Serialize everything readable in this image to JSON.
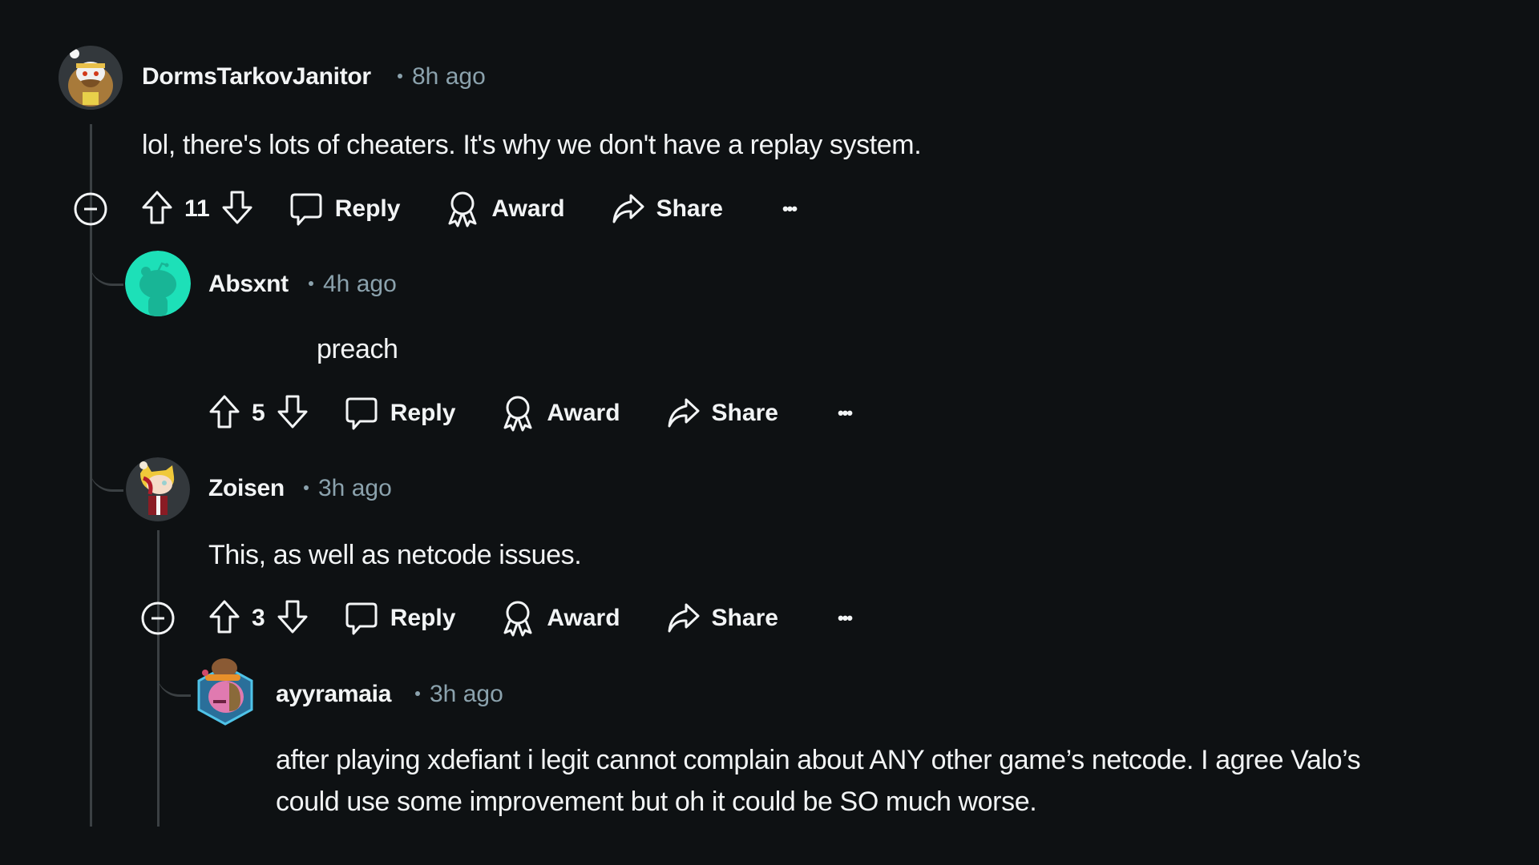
{
  "colors": {
    "background": "#0e1113",
    "text": "#f2f4f5",
    "meta_text": "#8ba2ad",
    "thread_line": "#3b4043",
    "absxnt_avatar": "#1de0b8"
  },
  "comments": [
    {
      "username": "DormsTarkovJanitor",
      "time": "8h ago",
      "body": "lol, there's lots of cheaters. It's why we don't have a replay system.",
      "votes": "11",
      "avatar_icon": "snoo-avatar-janitor-icon"
    },
    {
      "username": "Absxnt",
      "time": "4h ago",
      "body": "preach",
      "votes": "5",
      "avatar_icon": "default-snoo-avatar-icon"
    },
    {
      "username": "Zoisen",
      "time": "3h ago",
      "body": "This, as well as netcode issues.",
      "votes": "3",
      "avatar_icon": "snoo-avatar-tiger-hood-icon"
    },
    {
      "username": "ayyramaia",
      "time": "3h ago",
      "body_lines": [
        "after playing xdefiant i legit cannot complain about ANY other game’s netcode. I agree Valo’s",
        "could use some improvement but oh it could be SO much worse."
      ],
      "avatar_icon": "nft-hexagon-avatar-icon"
    }
  ],
  "actions": {
    "reply": "Reply",
    "award": "Award",
    "share": "Share",
    "more": "•••"
  }
}
